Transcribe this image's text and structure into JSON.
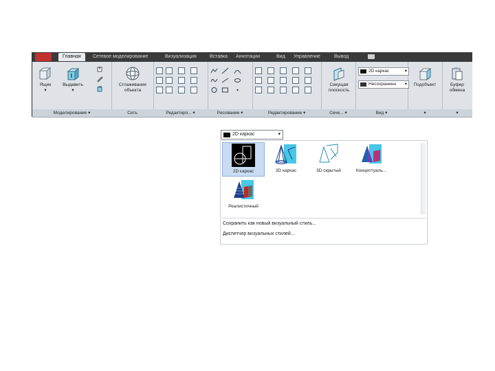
{
  "ribbon": {
    "tabs": [
      {
        "label": "Главная",
        "active": true
      },
      {
        "label": "Сетевое моделирование",
        "active": false
      },
      {
        "label": "Визуализация",
        "active": false
      },
      {
        "label": "Вставка",
        "active": false
      },
      {
        "label": "Аннотации",
        "active": false
      },
      {
        "label": "Вид",
        "active": false
      },
      {
        "label": "Управление",
        "active": false
      },
      {
        "label": "Вывод",
        "active": false
      }
    ],
    "panels": {
      "modeling": {
        "footer": "Моделирование ▾",
        "box_label": "Ящик",
        "extrude_label": "Выдавить"
      },
      "mesh": {
        "footer": "Сеть",
        "smooth_label_1": "Сглаживание",
        "smooth_label_2": "объекта"
      },
      "edit": {
        "footer": "Редактиро... ▾"
      },
      "draw": {
        "footer": "Рисование ▾"
      },
      "modify": {
        "footer": "Редактирование ▾"
      },
      "section": {
        "footer": "Сече... ▾",
        "plane_label_1": "Секущая",
        "plane_label_2": "плоскость"
      },
      "view": {
        "footer": "Вид ▾",
        "visual_style": "2D каркас",
        "shading": "Несохраненн"
      },
      "subobject": {
        "label": "Подобъект",
        "footer": "▾"
      },
      "clipboard": {
        "label_1": "Буфер",
        "label_2": "обмена",
        "footer": "▾"
      }
    }
  },
  "visual_style_dropdown": {
    "current": "2D каркас",
    "items": [
      {
        "label": "2D каркас",
        "selected": true
      },
      {
        "label": "3D каркас",
        "selected": false
      },
      {
        "label": "3D скрытый",
        "selected": false
      },
      {
        "label": "Концептуаль...",
        "selected": false
      },
      {
        "label": "Реалистичный",
        "selected": false
      }
    ],
    "commands": [
      "Сохранить как новый визуальный стиль...",
      "Диспетчер визуальных стилей..."
    ]
  },
  "colors": {
    "ribbon_bg": "#dfe3e8",
    "tabbar_bg": "#3a3a3a",
    "app_button": "#c0312f",
    "selection": "#c9dcf3",
    "thumb_cyan": "#47c8e6"
  }
}
